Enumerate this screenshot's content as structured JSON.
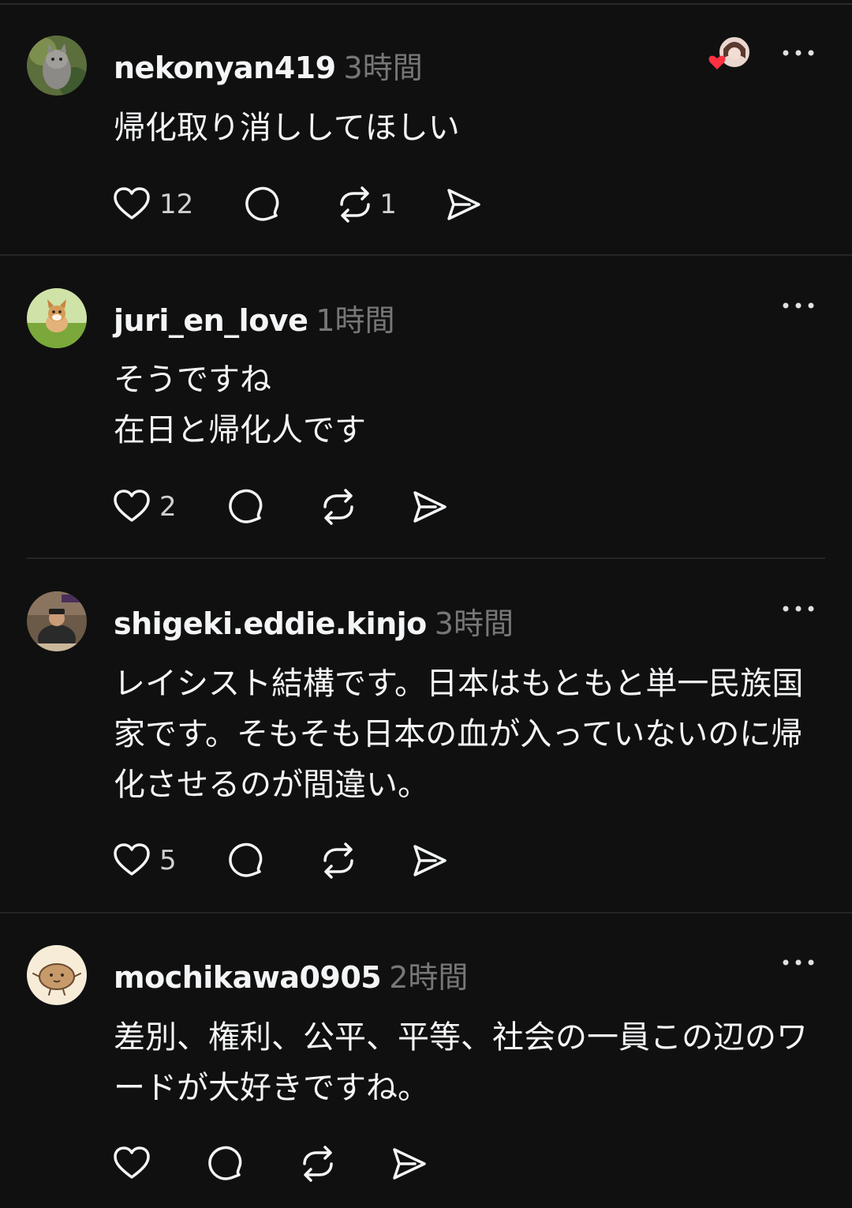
{
  "posts": [
    {
      "username": "nekonyan419",
      "time": "3時間",
      "text": "帰化取り消ししてほしい",
      "likes": "12",
      "reposts": "1",
      "avatar_icon": "cat-avatar-icon"
    },
    {
      "username": "juri_en_love",
      "time": "1時間",
      "text": "そうですね\n在日と帰化人です",
      "likes": "2",
      "reposts": "",
      "avatar_icon": "dog-avatar-icon"
    },
    {
      "username": "shigeki.eddie.kinjo",
      "time": "3時間",
      "text": "レイシスト結構です。日本はもともと単一民族国家です。そもそも日本の血が入っていないのに帰化させるのが間違い。",
      "likes": "5",
      "reposts": "",
      "avatar_icon": "person-avatar-icon"
    },
    {
      "username": "mochikawa0905",
      "time": "2時間",
      "text": "差別、権利、公平、平等、社会の一員この辺のワードが大好きですね。",
      "likes": "",
      "reposts": "",
      "avatar_icon": "mochi-avatar-icon"
    }
  ],
  "colors": {
    "background": "#101010",
    "text_primary": "#f3f5f7",
    "text_secondary": "#777777",
    "like_heart": "#ff3040",
    "divider": "#262626"
  }
}
